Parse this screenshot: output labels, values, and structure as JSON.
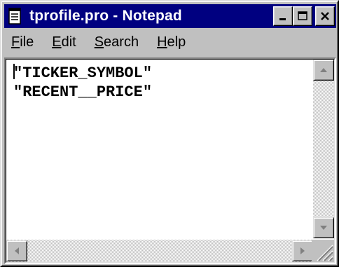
{
  "window": {
    "title": "tprofile.pro - Notepad",
    "icons": {
      "app": "notepad-icon",
      "minimize": "minimize-icon",
      "maximize": "maximize-icon",
      "close": "close-icon"
    }
  },
  "menu": {
    "file": {
      "mnemonic": "F",
      "rest": "ile"
    },
    "edit": {
      "mnemonic": "E",
      "rest": "dit"
    },
    "search": {
      "mnemonic": "S",
      "rest": "earch"
    },
    "help": {
      "mnemonic": "H",
      "rest": "elp"
    }
  },
  "editor": {
    "lines": [
      "\"TICKER_SYMBOL\"",
      "\"RECENT__PRICE\""
    ]
  },
  "colors": {
    "titlebar": "#000080",
    "face": "#c0c0c0",
    "text_background": "#ffffff"
  }
}
